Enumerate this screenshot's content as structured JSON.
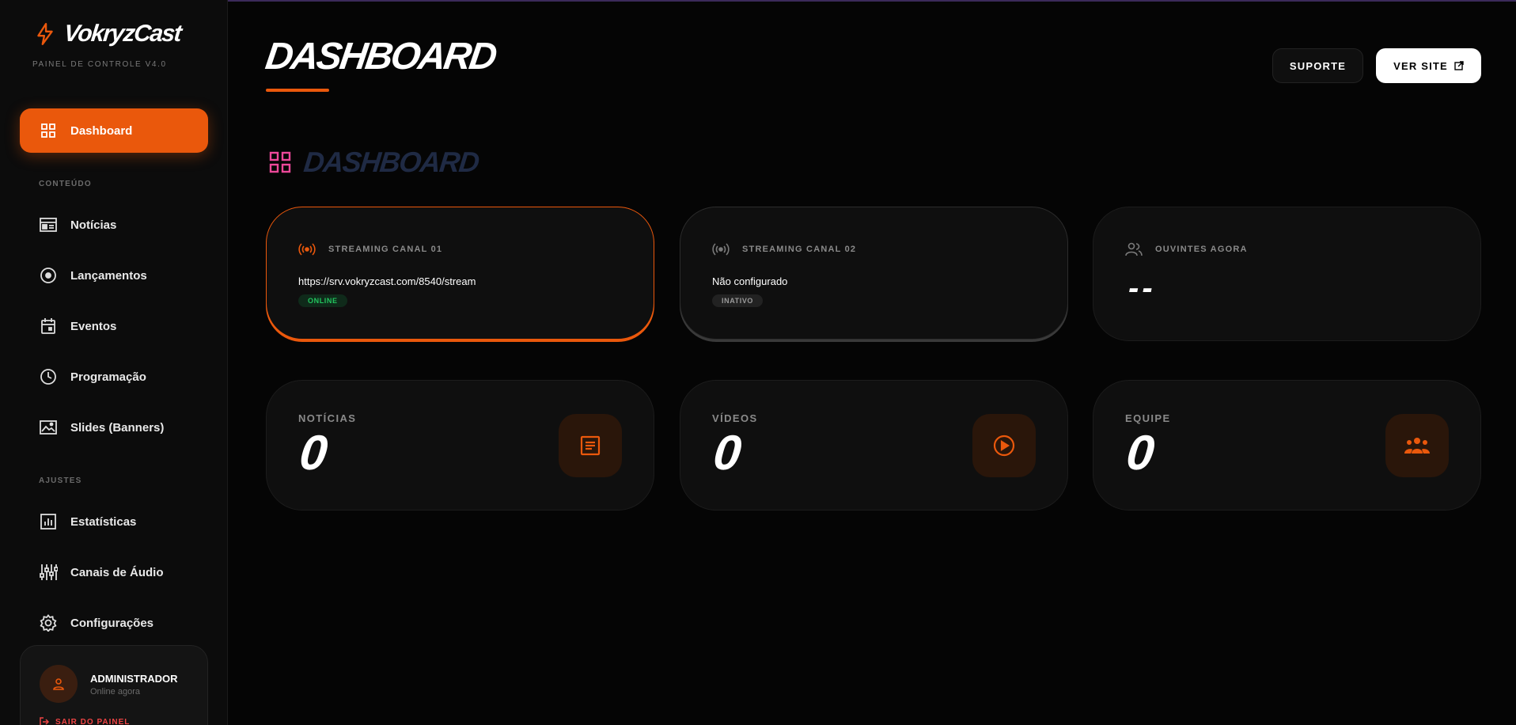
{
  "brand": {
    "name": "VokryzCast",
    "subtitle": "PAINEL DE CONTROLE V4.0",
    "accent": "#ea580c"
  },
  "sidebar": {
    "active": {
      "label": "Dashboard",
      "icon": "grid-icon"
    },
    "sections": [
      {
        "label": "CONTEÚDO",
        "items": [
          {
            "label": "Notícias",
            "icon": "newspaper-icon"
          },
          {
            "label": "Lançamentos",
            "icon": "disc-icon"
          },
          {
            "label": "Eventos",
            "icon": "calendar-icon"
          },
          {
            "label": "Programação",
            "icon": "clock-icon"
          },
          {
            "label": "Slides (Banners)",
            "icon": "image-icon"
          }
        ]
      },
      {
        "label": "AJUSTES",
        "items": [
          {
            "label": "Estatísticas",
            "icon": "bar-chart-icon"
          },
          {
            "label": "Canais de Áudio",
            "icon": "equalizer-icon"
          },
          {
            "label": "Configurações",
            "icon": "gear-icon"
          }
        ]
      }
    ],
    "user": {
      "name": "ADMINISTRADOR",
      "status": "Online agora",
      "logout": "SAIR DO PAINEL"
    }
  },
  "header": {
    "title": "DASHBOARD",
    "support_label": "SUPORTE",
    "site_label": "VER SITE"
  },
  "section": {
    "title": "DASHBOARD"
  },
  "streams": [
    {
      "label": "STREAMING CANAL 01",
      "value": "https://srv.vokryzcast.com/8540/stream",
      "status": "ONLINE"
    },
    {
      "label": "STREAMING CANAL 02",
      "value": "Não configurado",
      "status": "INATIVO"
    }
  ],
  "listeners": {
    "label": "OUVINTES AGORA",
    "value": "--"
  },
  "stats": [
    {
      "label": "NOTÍCIAS",
      "value": "0",
      "icon": "article-icon"
    },
    {
      "label": "VÍDEOS",
      "value": "0",
      "icon": "play-icon"
    },
    {
      "label": "EQUIPE",
      "value": "0",
      "icon": "team-icon"
    }
  ]
}
